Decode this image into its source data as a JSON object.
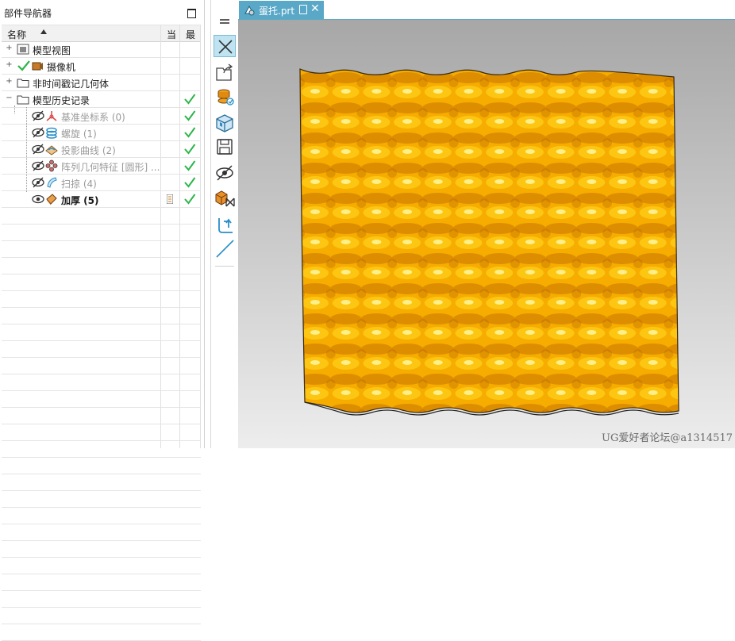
{
  "navigator": {
    "title": "部件导航器",
    "columns": {
      "name": "名称",
      "current": "当",
      "latest": "最"
    },
    "nodes": [
      {
        "label": "模型视图",
        "expander": "+",
        "icon": "model-view-icon"
      },
      {
        "label": "摄像机",
        "expander": "+",
        "icon": "camera-icon"
      },
      {
        "label": "非时间戳记几何体",
        "expander": "+",
        "icon": "folder-icon"
      },
      {
        "label": "模型历史记录",
        "expander": "−",
        "icon": "folder-icon"
      },
      {
        "label": "基准坐标系 (0)",
        "icon": "datum-csys-icon"
      },
      {
        "label": "螺旋 (1)",
        "icon": "helix-icon"
      },
      {
        "label": "投影曲线 (2)",
        "icon": "projected-curve-icon"
      },
      {
        "label": "阵列几何特征 [圆形] ...",
        "icon": "pattern-geometry-icon"
      },
      {
        "label": "扫掠 (4)",
        "icon": "swept-icon"
      },
      {
        "label": "加厚 (5)",
        "icon": "thicken-icon"
      }
    ]
  },
  "toolbar": {
    "items": [
      "menu-icon",
      "close-view-icon",
      "export-icon",
      "layer-icon",
      "view-cube-icon",
      "save-icon",
      "hide-icon",
      "part-icon",
      "return-icon",
      "line-icon"
    ]
  },
  "tab": {
    "label": "蛋托.prt"
  },
  "watermark": "UG爱好者论坛@a1314517",
  "colors": {
    "accent": "#5aa8c8",
    "check": "#2db54a",
    "surface": "#f5a800"
  }
}
